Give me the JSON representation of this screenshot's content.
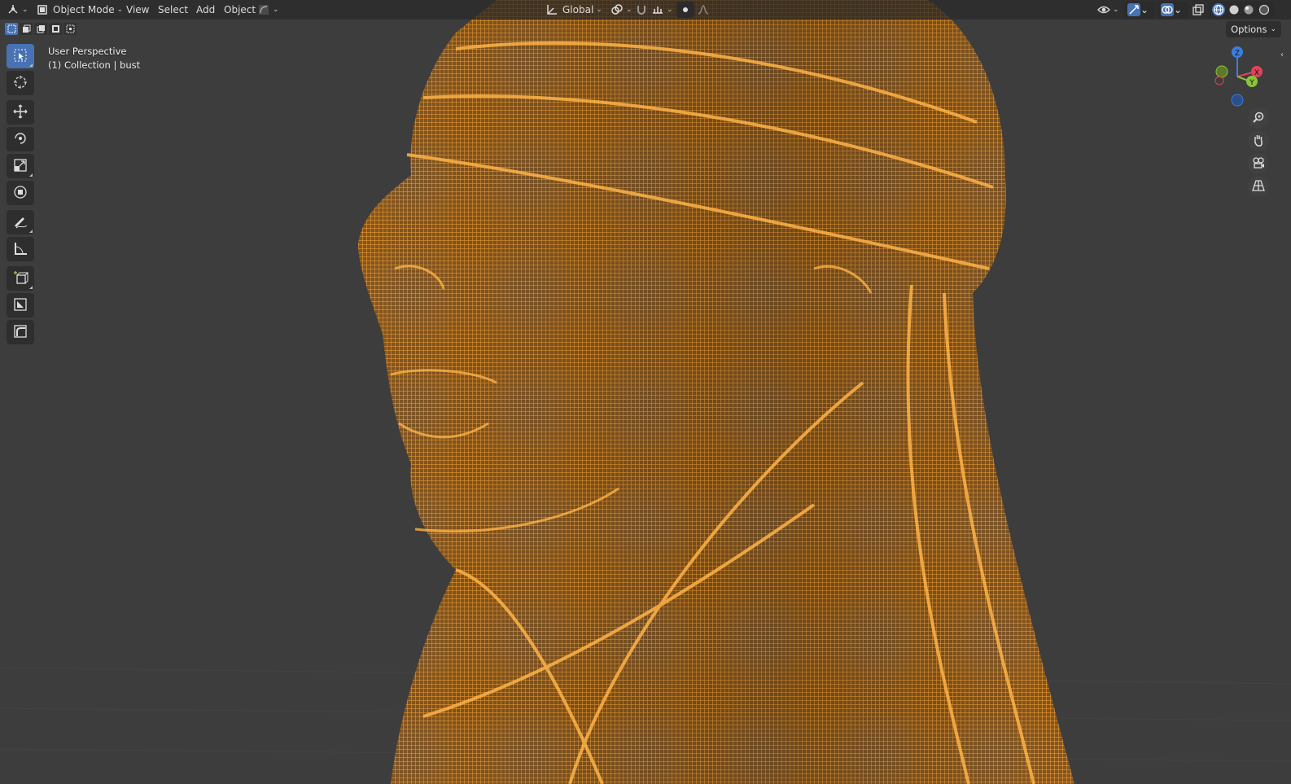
{
  "header": {
    "mode_label": "Object Mode",
    "menus": [
      "View",
      "Select",
      "Add",
      "Object"
    ],
    "transform_orientation": "Global"
  },
  "options_label": "Options",
  "overlay": {
    "view_name": "User Perspective",
    "collection_line": "(1) Collection | bust"
  },
  "gizmo": {
    "z": "Z",
    "x": "X",
    "y": "Y"
  },
  "colors": {
    "accent": "#4772b3",
    "wire": "#f5a033",
    "viewport_bg": "#3d3d3d",
    "axis_x": "#e0435b",
    "axis_y": "#8bc33b",
    "axis_z": "#3c7ee0"
  },
  "icons": {
    "editor_type": "viewport-icon",
    "tools": [
      "select-box-icon",
      "cursor-icon",
      "move-icon",
      "rotate-icon",
      "scale-icon",
      "transform-icon",
      "annotate-icon",
      "measure-icon",
      "add-cube-icon",
      "shrink-icon",
      "bevel-icon"
    ]
  }
}
